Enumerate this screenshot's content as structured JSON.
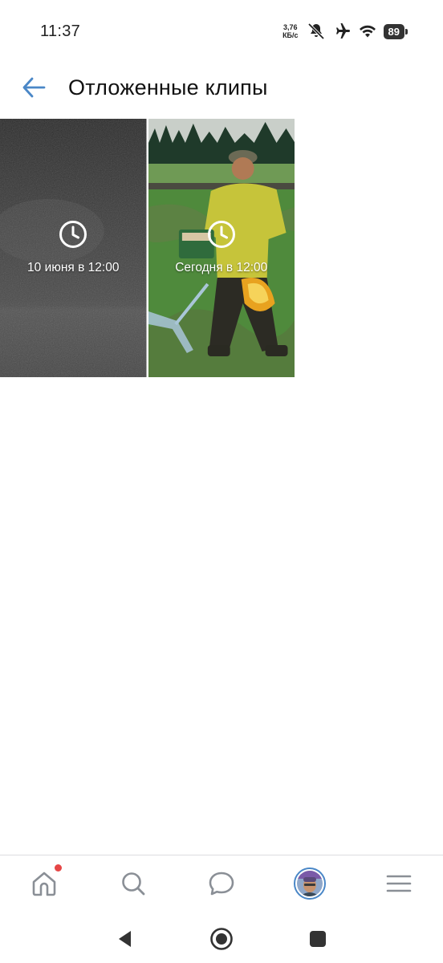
{
  "status_bar": {
    "time": "11:37",
    "net_speed_value": "3,76",
    "net_speed_unit": "КБ/с",
    "battery": "89",
    "icons": [
      "mute-bell-icon",
      "airplane-mode-icon",
      "wifi-icon",
      "battery-icon"
    ]
  },
  "header": {
    "back_icon": "arrow-left-icon",
    "title": "Отложенные клипы"
  },
  "clips": [
    {
      "date": "10 июня в 12:00",
      "icon": "clock-icon",
      "thumbnail": "dark-grainy-night-footage"
    },
    {
      "date": "Сегодня в 12:00",
      "icon": "clock-icon",
      "thumbnail": "man-in-field-with-basket"
    }
  ],
  "bottom_nav": {
    "items": [
      {
        "name": "home",
        "icon": "home-icon",
        "has_notification": true
      },
      {
        "name": "search",
        "icon": "search-icon"
      },
      {
        "name": "messages",
        "icon": "chat-bubble-icon"
      },
      {
        "name": "profile",
        "icon": "avatar"
      },
      {
        "name": "menu",
        "icon": "hamburger-menu-icon"
      }
    ]
  },
  "system_nav": {
    "items": [
      "back-triangle-icon",
      "home-circle-icon",
      "recents-square-icon"
    ]
  },
  "colors": {
    "accent": "#4a87c7",
    "icon_gray": "#8a8f96",
    "notification": "#e64646",
    "divider": "#dcdde0"
  }
}
